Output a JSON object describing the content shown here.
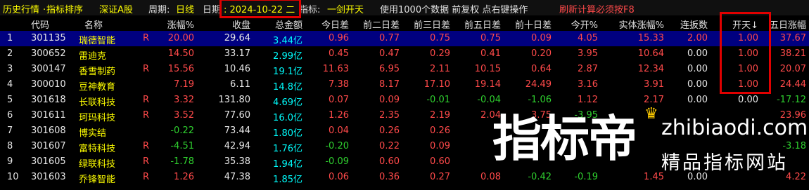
{
  "topbar": {
    "tab1": "历史行情",
    "tab2": "指标排序",
    "tab3": "深证A股",
    "period_label": "周期:",
    "period_value": "日线",
    "date_label": "日期",
    "date_value": ": 2024-10-22 二",
    "indicator_label": "指标:",
    "indicator_value": "一剑开天",
    "info1": "使用1000个数据 前复权 点右键操作",
    "info2": "刷新计算必须按F8"
  },
  "columns": [
    "代码",
    "名称",
    "涨幅%",
    "收盘",
    "总金额",
    "今日差",
    "前二日差",
    "前三日差",
    "前五日差",
    "前十日差",
    "今开%",
    "实体涨幅%",
    "连扳数",
    "开天↓",
    "五日涨幅"
  ],
  "rows": [
    {
      "n": "1",
      "code": "301135",
      "name": "瑞德智能",
      "r": "R",
      "chg": "20.00",
      "close": "29.64",
      "amt": "3.44亿",
      "d0": "0.96",
      "d2": "0.77",
      "d3": "0.75",
      "d5": "0.75",
      "d10": "0.09",
      "open": "4.05",
      "body": "15.33",
      "lb": "2.00",
      "kt": "1.00",
      "w5": "37.67"
    },
    {
      "n": "2",
      "code": "300652",
      "name": "雷迪克",
      "r": "",
      "chg": "14.50",
      "close": "33.17",
      "amt": "2.99亿",
      "d0": "0.45",
      "d2": "0.47",
      "d3": "0.29",
      "d5": "0.41",
      "d10": "0.20",
      "open": "3.95",
      "body": "10.64",
      "lb": "0.00",
      "kt": "1.00",
      "w5": "38.21"
    },
    {
      "n": "3",
      "code": "300147",
      "name": "香雪制药",
      "r": "R",
      "chg": "15.56",
      "close": "10.46",
      "amt": "19.1亿",
      "d0": "11.63",
      "d2": "6.95",
      "d3": "2.11",
      "d5": "10.15",
      "d10": "0.64",
      "open": "2.87",
      "body": "12.34",
      "lb": "0.00",
      "kt": "1.00",
      "w5": "20.07"
    },
    {
      "n": "4",
      "code": "300010",
      "name": "豆神教育",
      "r": "",
      "chg": "7.19",
      "close": "6.11",
      "amt": "14.8亿",
      "d0": "7.38",
      "d2": "8.17",
      "d3": "17.10",
      "d5": "19.14",
      "d10": "24.49",
      "open": "3.16",
      "body": "3.91",
      "lb": "0.00",
      "kt": "1.00",
      "w5": "24.44"
    },
    {
      "n": "5",
      "code": "301618",
      "name": "长联科技",
      "r": "R",
      "chg": "3.32",
      "close": "131.80",
      "amt": "4.69亿",
      "d0": "0.07",
      "d2": "0.09",
      "d3": "-0.01",
      "d5": "-0.04",
      "d10": "-1.06",
      "open": "1.12",
      "body": "2.17",
      "lb": "0.00",
      "kt": "0.00",
      "w5": "-17.12"
    },
    {
      "n": "6",
      "code": "301611",
      "name": "珂玛科技",
      "r": "R",
      "chg": "3.52",
      "close": "77.60",
      "amt": "16.0亿",
      "d0": "1.26",
      "d2": "2.35",
      "d3": "2.19",
      "d5": "2.04",
      "d10": "3.75",
      "open": "-3.95",
      "body": "",
      "lb": "",
      "kt": "",
      "w5": "23.96"
    },
    {
      "n": "7",
      "code": "301608",
      "name": "博实结",
      "r": "",
      "chg": "-0.22",
      "close": "73.44",
      "amt": "1.80亿",
      "d0": "0.04",
      "d2": "0.26",
      "d3": "0.26",
      "d5": "",
      "d10": "",
      "open": "",
      "body": "",
      "lb": "",
      "kt": "",
      "w5": ""
    },
    {
      "n": "8",
      "code": "301607",
      "name": "富特科技",
      "r": "R",
      "chg": "-4.51",
      "close": "42.94",
      "amt": "1.76亿",
      "d0": "-0.20",
      "d2": "0.22",
      "d3": "0.09",
      "d5": "",
      "d10": "",
      "open": "",
      "body": "",
      "lb": "",
      "kt": "",
      "w5": "-3.18"
    },
    {
      "n": "9",
      "code": "301605",
      "name": "绿联科技",
      "r": "R",
      "chg": "-1.78",
      "close": "35.38",
      "amt": "1.94亿",
      "d0": "-0.09",
      "d2": "0.60",
      "d3": "0.60",
      "d5": "",
      "d10": "",
      "open": "",
      "body": "",
      "lb": "",
      "kt": "",
      "w5": ""
    },
    {
      "n": "10",
      "code": "301603",
      "name": "乔锋智能",
      "r": "R",
      "chg": "1.26",
      "close": "47.38",
      "amt": "1.85亿",
      "d0": "0.06",
      "d2": "0.36",
      "d3": "0.27",
      "d5": "0.08",
      "d10": "-0.42",
      "open": "-0.19",
      "body": "1.45",
      "lb": "0.00",
      "kt": "",
      "w5": "4.22"
    }
  ],
  "watermark": {
    "big": "指标帝",
    "url": "zhibiaodi.com",
    "slogan": "精品指标网站"
  },
  "colors": {
    "up": "#ff4a4a",
    "down": "#2fd02f",
    "amount": "#00ffff",
    "selected_row": "#000080",
    "highlight_box": "#e00000"
  }
}
